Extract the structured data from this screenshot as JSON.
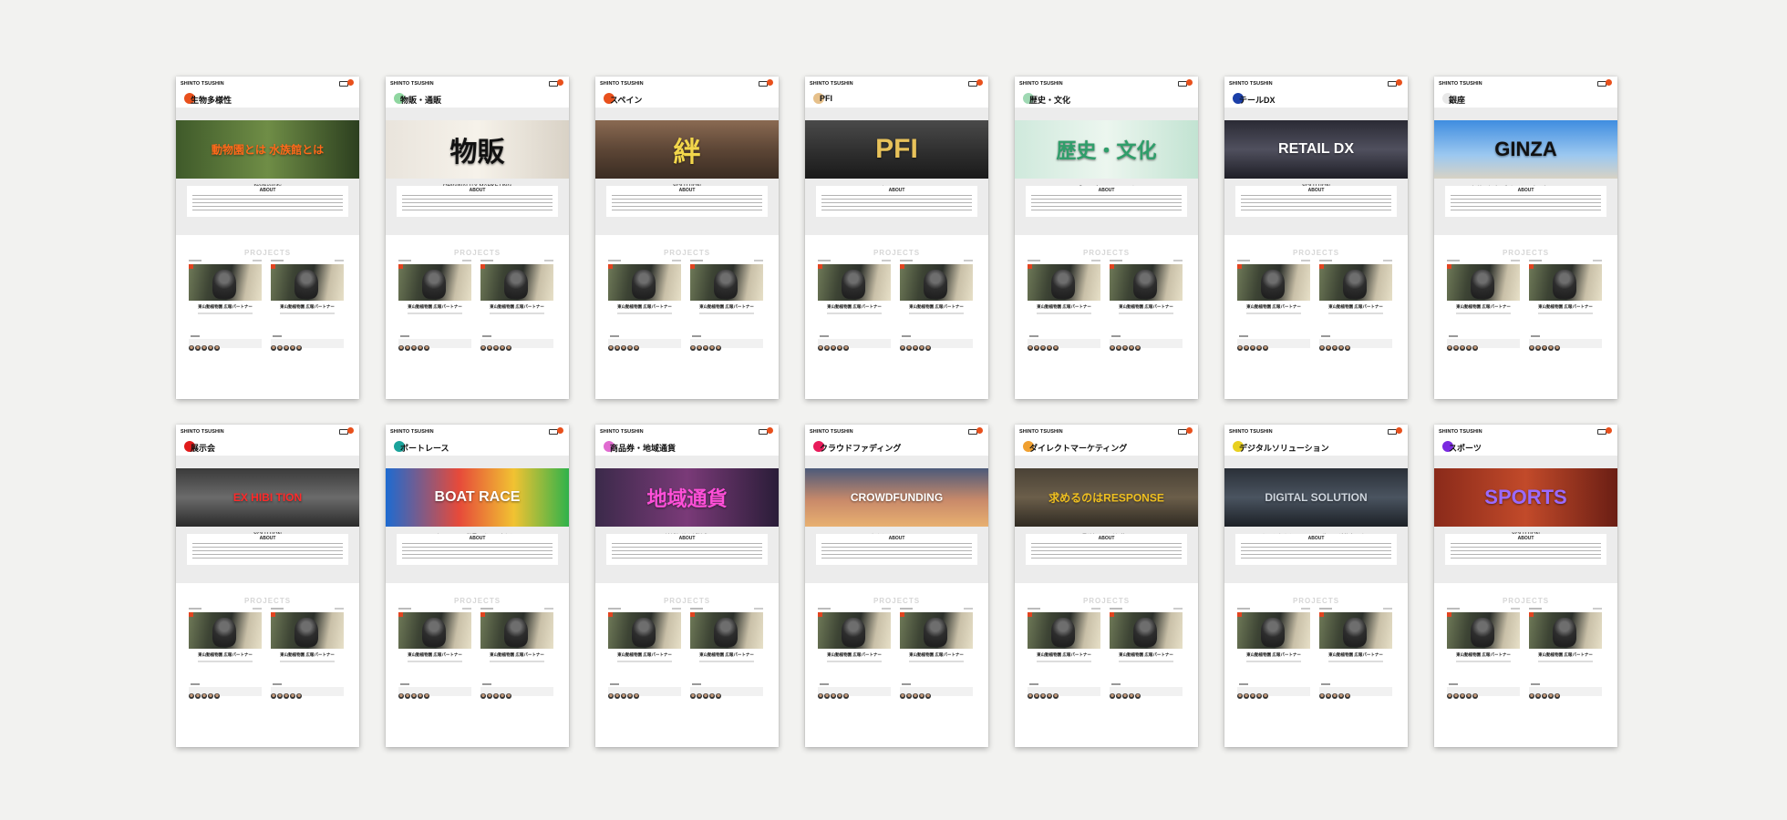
{
  "brand": "SHINTO TSUSHIN",
  "cards": [
    {
      "title": "生物多様性",
      "dot_color": "#e8501c",
      "hero_text": "動物園とは 水族館とは",
      "hero_bg": "linear-gradient(90deg,#3f5a2a,#6f8d46 50%,#2c3f1f)",
      "hero_accent": "#ff6a1a",
      "hero_sub": "biodiversity",
      "project_caption": "東山動植物園 広報パートナー"
    },
    {
      "title": "物販・通販",
      "dot_color": "#8fd6a0",
      "hero_text": "物販",
      "hero_bg": "linear-gradient(90deg,#e9e4dc,#f6f2ea 50%,#d9d2c6)",
      "hero_accent": "#111111",
      "hero_sub": "ORIGINALITY MARKETING",
      "project_caption": "東山動植物園 広報パートナー"
    },
    {
      "title": "スペイン",
      "dot_color": "#e8501c",
      "hero_text": "絆",
      "hero_bg": "linear-gradient(180deg,#8a6a52,#5d4636 50%,#3a2c22)",
      "hero_accent": "#f2d64b",
      "hero_sub": "SOLUTION",
      "project_caption": "東山動植物園 広報パートナー"
    },
    {
      "title": "PFI",
      "dot_color": "#e6c08a",
      "hero_text": "PFI",
      "hero_bg": "linear-gradient(180deg,#4a4a4a,#2c2c2c 60%,#1a1a1a)",
      "hero_accent": "#e8c25a",
      "hero_sub": "エンターテインメント",
      "project_caption": "東山動植物園 広報パートナー"
    },
    {
      "title": "歴史・文化",
      "dot_color": "#9fd8b3",
      "hero_text": "歴史・文化",
      "hero_bg": "linear-gradient(90deg,#cfe9dc,#ecf6ef 50%,#c2e3d2)",
      "hero_accent": "#2f9e6a",
      "hero_sub": "「ニッポンのこころ」を",
      "project_caption": "東山動植物園 広報パートナー"
    },
    {
      "title": "テールDX",
      "dot_color": "#1b3fa8",
      "hero_text": "RETAIL DX",
      "hero_bg": "linear-gradient(180deg,#2a2a34,#50505e 50%,#1e1e26)",
      "hero_accent": "#ffffff",
      "hero_sub": "SOLUTION",
      "project_caption": "東山動植物園 広報パートナー"
    },
    {
      "title": "銀座",
      "dot_color": "#e8e8e8",
      "hero_text": "GINZA",
      "hero_bg": "linear-gradient(180deg,#3f8de0,#9cc8f0 60%,#d8d2c4)",
      "hero_accent": "#111111",
      "hero_sub": "10年続く銀座の街おこし、今、次のステージへ。",
      "project_caption": "東山動植物園 広報パートナー"
    },
    {
      "title": "展示会",
      "dot_color": "#e01b1b",
      "hero_text": "EX HIBI TION",
      "hero_bg": "linear-gradient(180deg,#3a3a3a,#6b6b6b 50%,#2a2a2a)",
      "hero_accent": "#ff2a2a",
      "hero_sub": "SOLUTION",
      "project_caption": "東山動植物園 広報パートナー"
    },
    {
      "title": "ボートレース",
      "dot_color": "#1aa39b",
      "hero_text": "BOAT RACE",
      "hero_bg": "linear-gradient(90deg,#1d6bd1,#e64a3a 40%,#f1c232 70%,#2fb24a)",
      "hero_accent": "#ffffff",
      "hero_sub": "ボートレース業界の発展に寄与し、",
      "project_caption": "東山動植物園 広報パートナー"
    },
    {
      "title": "商品券・地域通貨",
      "dot_color": "#e06bd0",
      "hero_text": "地域通貨",
      "hero_bg": "linear-gradient(90deg,#3b2a4a,#7a3a78 50%,#2a1d38)",
      "hero_accent": "#ff4fd8",
      "hero_sub": "地域経済を活性化",
      "project_caption": "東山動植物園 広報パートナー"
    },
    {
      "title": "クラウドファディング",
      "dot_color": "#e81b5a",
      "hero_text": "CROWDFUNDING",
      "hero_bg": "linear-gradient(180deg,#4c5a7a,#c98a6a 55%,#e8b070)",
      "hero_accent": "#ffffff",
      "hero_sub": "おもしろい モノ コト",
      "project_caption": "東山動植物園 広報パートナー"
    },
    {
      "title": "ダイレクトマーケティング",
      "dot_color": "#f0a030",
      "hero_text": "求めるのはRESPONSE",
      "hero_bg": "linear-gradient(180deg,#4a4236,#6b5e4a 50%,#2f2a22)",
      "hero_accent": "#f0c020",
      "hero_sub": "最適解にたどり着く",
      "project_caption": "東山動植物園 広報パートナー"
    },
    {
      "title": "デジタルソリューション",
      "dot_color": "#e8d020",
      "hero_text": "DIGITAL SOLUTION",
      "hero_bg": "linear-gradient(180deg,#2a3038,#4a5460 50%,#1c2026)",
      "hero_accent": "#cfd6de",
      "hero_sub": "もっとおもしろいことで遊ぶのが仕事です？",
      "project_caption": "東山動植物園 広報パートナー"
    },
    {
      "title": "スポーツ",
      "dot_color": "#7a2ae0",
      "hero_text": "SPORTS",
      "hero_bg": "linear-gradient(90deg,#8a2a1a,#c24a2a 50%,#6a1e14)",
      "hero_accent": "#9a6aff",
      "hero_sub": "SOLUTION",
      "project_caption": "東山動植物園 広報パートナー"
    }
  ]
}
